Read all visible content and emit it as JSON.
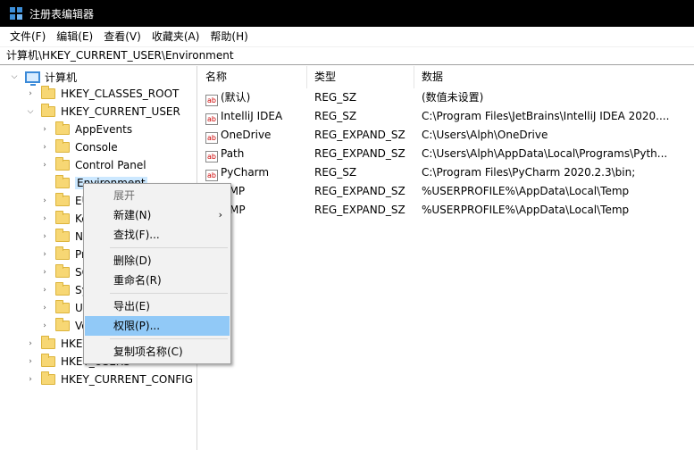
{
  "window": {
    "title": "注册表编辑器"
  },
  "menubar": [
    "文件(F)",
    "编辑(E)",
    "查看(V)",
    "收藏夹(A)",
    "帮助(H)"
  ],
  "address": "计算机\\HKEY_CURRENT_USER\\Environment",
  "tree": {
    "root": "计算机",
    "hkcr": "HKEY_CLASSES_ROOT",
    "hkcu": "HKEY_CURRENT_USER",
    "hkcu_children": [
      "AppEvents",
      "Console",
      "Control Panel",
      "Environment",
      "EU",
      "Ke",
      "Ne",
      "Pri",
      "SO",
      "Sy",
      "Un",
      "Vo"
    ],
    "hklm": "HKEY",
    "hku": "HKEY_USERS",
    "hkcc": "HKEY_CURRENT_CONFIG"
  },
  "values": {
    "columns": [
      "名称",
      "类型",
      "数据"
    ],
    "rows": [
      {
        "name": "(默认)",
        "type": "REG_SZ",
        "data": "(数值未设置)"
      },
      {
        "name": "IntelliJ IDEA",
        "type": "REG_SZ",
        "data": "C:\\Program Files\\JetBrains\\IntelliJ IDEA 2020...."
      },
      {
        "name": "OneDrive",
        "type": "REG_EXPAND_SZ",
        "data": "C:\\Users\\Alph\\OneDrive"
      },
      {
        "name": "Path",
        "type": "REG_EXPAND_SZ",
        "data": "C:\\Users\\Alph\\AppData\\Local\\Programs\\Pyth..."
      },
      {
        "name": "PyCharm",
        "type": "REG_SZ",
        "data": "C:\\Program Files\\PyCharm 2020.2.3\\bin;"
      },
      {
        "name": "EMP",
        "type": "REG_EXPAND_SZ",
        "data": "%USERPROFILE%\\AppData\\Local\\Temp"
      },
      {
        "name": "MP",
        "type": "REG_EXPAND_SZ",
        "data": "%USERPROFILE%\\AppData\\Local\\Temp"
      }
    ]
  },
  "context_menu": {
    "items": [
      "展开",
      "新建(N)",
      "查找(F)...",
      "删除(D)",
      "重命名(R)",
      "导出(E)",
      "权限(P)...",
      "复制项名称(C)"
    ],
    "highlighted": "权限(P)..."
  }
}
